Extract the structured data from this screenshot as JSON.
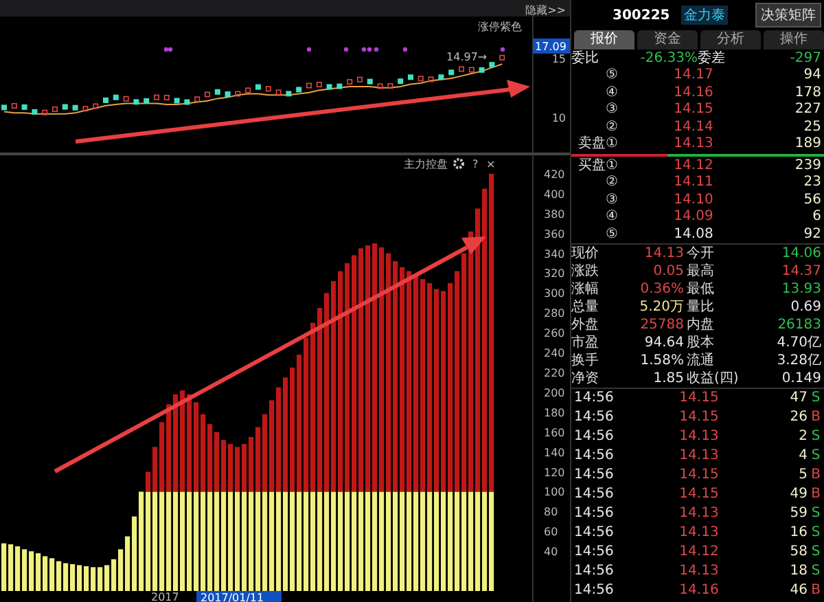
{
  "chart_area": {
    "hide_button": "隐藏>>",
    "kline": {
      "price_tag": "17.09",
      "note_limit": "涨停紫色",
      "note_high": "14.97→",
      "chart_data": {
        "type": "line",
        "ylim": [
          7,
          18.5
        ],
        "yticks": [
          10,
          15
        ],
        "series": [
          {
            "color": "#e8a040",
            "values": [
              10.5,
              10.4,
              10.4,
              10.3,
              10.3,
              10.3,
              10.3,
              10.4,
              10.6,
              10.8,
              11.0,
              11.1,
              11.2,
              11.2,
              11.2,
              11.2,
              11.1,
              11.1,
              11.2,
              11.3,
              11.4,
              11.6,
              11.7,
              11.9,
              12.0,
              12.0,
              11.9,
              11.9,
              11.9,
              12.0,
              12.1,
              12.3,
              12.4,
              12.5,
              12.6,
              12.6,
              12.6,
              12.5,
              12.5,
              12.6,
              12.8,
              12.9,
              13.1,
              13.2,
              13.3,
              13.5,
              13.7,
              13.9,
              14.2,
              14.5
            ]
          }
        ]
      }
    },
    "indicator": {
      "help": "?",
      "close": "×",
      "x_label": "2017",
      "date_tag": "2017/01/11",
      "chart_data": {
        "type": "bar",
        "title": "主力控盘",
        "stacked": true,
        "ylim": [
          0,
          440
        ],
        "yticks": [
          40,
          60,
          80,
          100,
          120,
          140,
          160,
          180,
          200,
          220,
          240,
          260,
          280,
          300,
          320,
          340,
          360,
          380,
          400,
          420
        ],
        "series": [
          {
            "color": "#f0f080",
            "values": [
              48,
              47,
              45,
              42,
              40,
              38,
              35,
              33,
              30,
              28,
              27,
              26,
              25,
              24,
              24,
              26,
              32,
              42,
              55,
              75,
              100,
              100,
              100,
              100,
              100,
              100,
              100,
              100,
              100,
              100,
              100,
              100,
              100,
              100,
              100,
              100,
              100,
              100,
              100,
              100,
              100,
              100,
              100,
              100,
              100,
              100,
              100,
              100,
              100,
              100,
              100,
              100,
              100,
              100,
              100,
              100,
              100,
              100,
              100,
              100,
              100,
              100,
              100,
              100,
              100,
              100,
              100,
              100,
              100,
              100,
              100,
              100
            ]
          },
          {
            "color": "#c01818",
            "values": [
              null,
              null,
              null,
              null,
              null,
              null,
              null,
              null,
              null,
              null,
              null,
              null,
              null,
              null,
              null,
              null,
              null,
              null,
              null,
              null,
              null,
              20,
              45,
              70,
              88,
              98,
              102,
              98,
              90,
              78,
              68,
              60,
              52,
              48,
              45,
              48,
              55,
              65,
              78,
              92,
              105,
              115,
              125,
              138,
              155,
              170,
              185,
              200,
              212,
              222,
              230,
              238,
              245,
              248,
              250,
              246,
              240,
              232,
              226,
              222,
              218,
              214,
              210,
              204,
              202,
              210,
              222,
              240,
              262,
              285,
              305,
              320
            ]
          }
        ]
      }
    }
  },
  "quote": {
    "code": "300225",
    "name": "金力泰",
    "button": "决策矩阵",
    "tabs": [
      {
        "label": "报价",
        "selected": true
      },
      {
        "label": "资金",
        "selected": false
      },
      {
        "label": "分析",
        "selected": false
      },
      {
        "label": "操作",
        "selected": false
      }
    ],
    "ratio": {
      "label": "委比",
      "value": "-26.33%",
      "label2": "委差",
      "value2": "-297"
    },
    "asks": [
      {
        "label": "⑤",
        "price": "14.17",
        "volume": "94",
        "color": "#e04848"
      },
      {
        "label": "④",
        "price": "14.16",
        "volume": "178",
        "color": "#e04848"
      },
      {
        "label": "③",
        "price": "14.15",
        "volume": "227",
        "color": "#e04848"
      },
      {
        "label": "②",
        "price": "14.14",
        "volume": "25",
        "color": "#e04848"
      },
      {
        "label": "卖盘①",
        "price": "14.13",
        "volume": "189",
        "color": "#e04848"
      }
    ],
    "balance": {
      "level": 0.38
    },
    "bids": [
      {
        "label": "买盘①",
        "price": "14.12",
        "volume": "239",
        "color": "#e04848"
      },
      {
        "label": "②",
        "price": "14.11",
        "volume": "23",
        "color": "#e04848"
      },
      {
        "label": "③",
        "price": "14.10",
        "volume": "56",
        "color": "#e04848"
      },
      {
        "label": "④",
        "price": "14.09",
        "volume": "6",
        "color": "#e04848"
      },
      {
        "label": "⑤",
        "price": "14.08",
        "volume": "92",
        "color": "#e8e8e8"
      }
    ],
    "stats": [
      {
        "label": "现价",
        "value": "14.13",
        "color": "#e04848"
      },
      {
        "label": "今开",
        "value": "14.06",
        "color": "#30c050"
      },
      {
        "label": "涨跌",
        "value": "0.05",
        "color": "#e04848"
      },
      {
        "label": "最高",
        "value": "14.37",
        "color": "#e04848"
      },
      {
        "label": "涨幅",
        "value": "0.36%",
        "color": "#e04848"
      },
      {
        "label": "最低",
        "value": "13.93",
        "color": "#30c050"
      },
      {
        "label": "总量",
        "value": "5.20万",
        "color": "#f0e68c"
      },
      {
        "label": "量比",
        "value": "0.69",
        "color": "#e8e8e8"
      },
      {
        "label": "外盘",
        "value": "25788",
        "color": "#e04848"
      },
      {
        "label": "内盘",
        "value": "26183",
        "color": "#30c050"
      },
      {
        "label": "市盈",
        "value": "94.64",
        "color": "#e8e8e8"
      },
      {
        "label": "股本",
        "value": "4.70亿",
        "color": "#e8e8e8"
      },
      {
        "label": "换手",
        "value": "1.58%",
        "color": "#e8e8e8"
      },
      {
        "label": "流通",
        "value": "3.28亿",
        "color": "#e8e8e8"
      },
      {
        "label": "净资",
        "value": "1.85",
        "color": "#e8e8e8"
      },
      {
        "label": "收益(四)",
        "value": "0.149",
        "color": "#e8e8e8"
      }
    ],
    "trades": [
      {
        "time": "14:56",
        "price": "14.15",
        "volume": "47",
        "side": "S",
        "color": "#30c050"
      },
      {
        "time": "14:56",
        "price": "14.15",
        "volume": "26",
        "side": "B",
        "color": "#e04848"
      },
      {
        "time": "14:56",
        "price": "14.13",
        "volume": "2",
        "side": "S",
        "color": "#30c050"
      },
      {
        "time": "14:56",
        "price": "14.13",
        "volume": "4",
        "side": "S",
        "color": "#30c050"
      },
      {
        "time": "14:56",
        "price": "14.15",
        "volume": "5",
        "side": "B",
        "color": "#e04848"
      },
      {
        "time": "14:56",
        "price": "14.15",
        "volume": "49",
        "side": "B",
        "color": "#e04848"
      },
      {
        "time": "14:56",
        "price": "14.13",
        "volume": "59",
        "side": "S",
        "color": "#30c050"
      },
      {
        "time": "14:56",
        "price": "14.13",
        "volume": "16",
        "side": "S",
        "color": "#30c050"
      },
      {
        "time": "14:56",
        "price": "14.12",
        "volume": "58",
        "side": "S",
        "color": "#30c050"
      },
      {
        "time": "14:56",
        "price": "14.13",
        "volume": "18",
        "side": "S",
        "color": "#30c050"
      },
      {
        "time": "14:56",
        "price": "14.16",
        "volume": "46",
        "side": "B",
        "color": "#e04848"
      }
    ]
  }
}
